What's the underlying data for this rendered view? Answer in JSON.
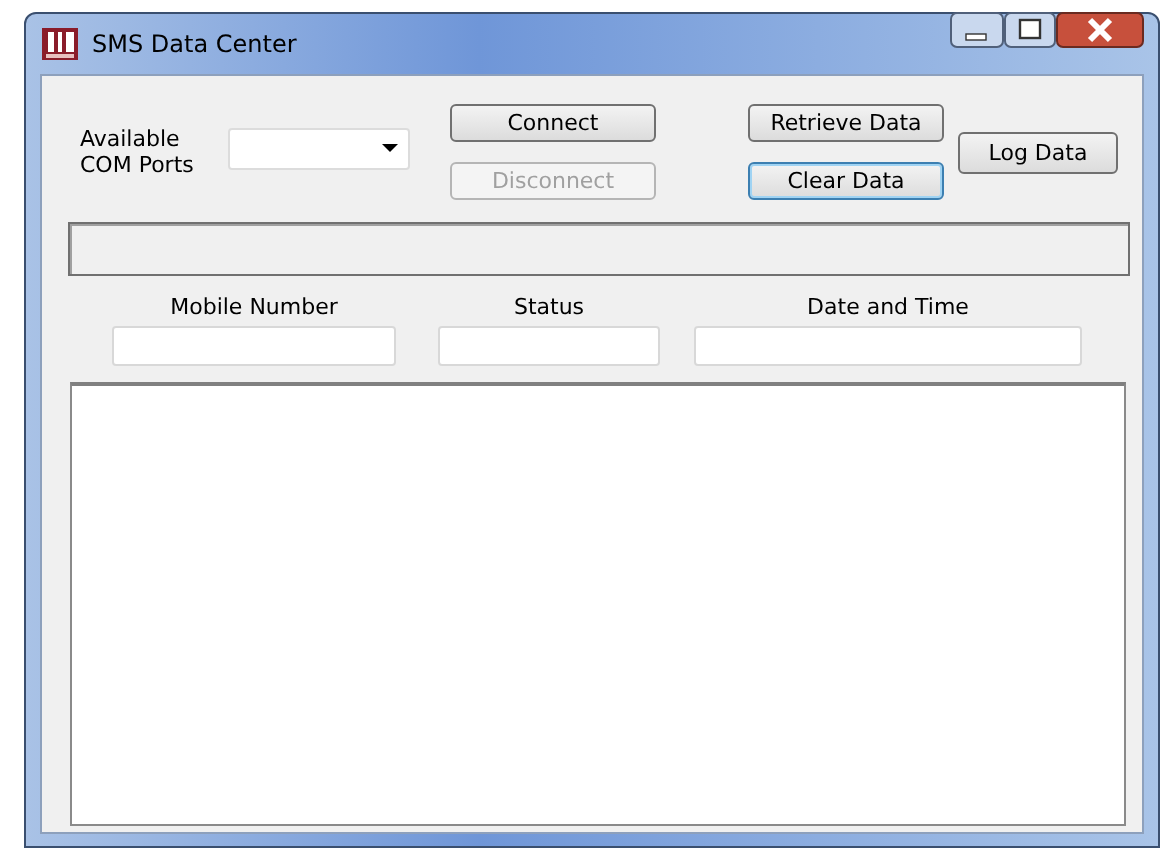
{
  "window": {
    "title": "SMS Data Center"
  },
  "com_ports": {
    "label": "Available COM Ports"
  },
  "connection_buttons": [
    {
      "label": "Connect",
      "disabled": false,
      "focused": false
    },
    {
      "label": "Disconnect",
      "disabled": true,
      "focused": false
    }
  ],
  "data_buttons": [
    {
      "label": "Retrieve Data",
      "disabled": false,
      "focused": false
    },
    {
      "label": "Clear Data",
      "disabled": false,
      "focused": true
    }
  ],
  "log_button": {
    "label": "Log Data",
    "disabled": false,
    "focused": false
  },
  "fields": [
    {
      "label": "Mobile Number"
    },
    {
      "label": "Status"
    },
    {
      "label": "Date and Time"
    }
  ]
}
